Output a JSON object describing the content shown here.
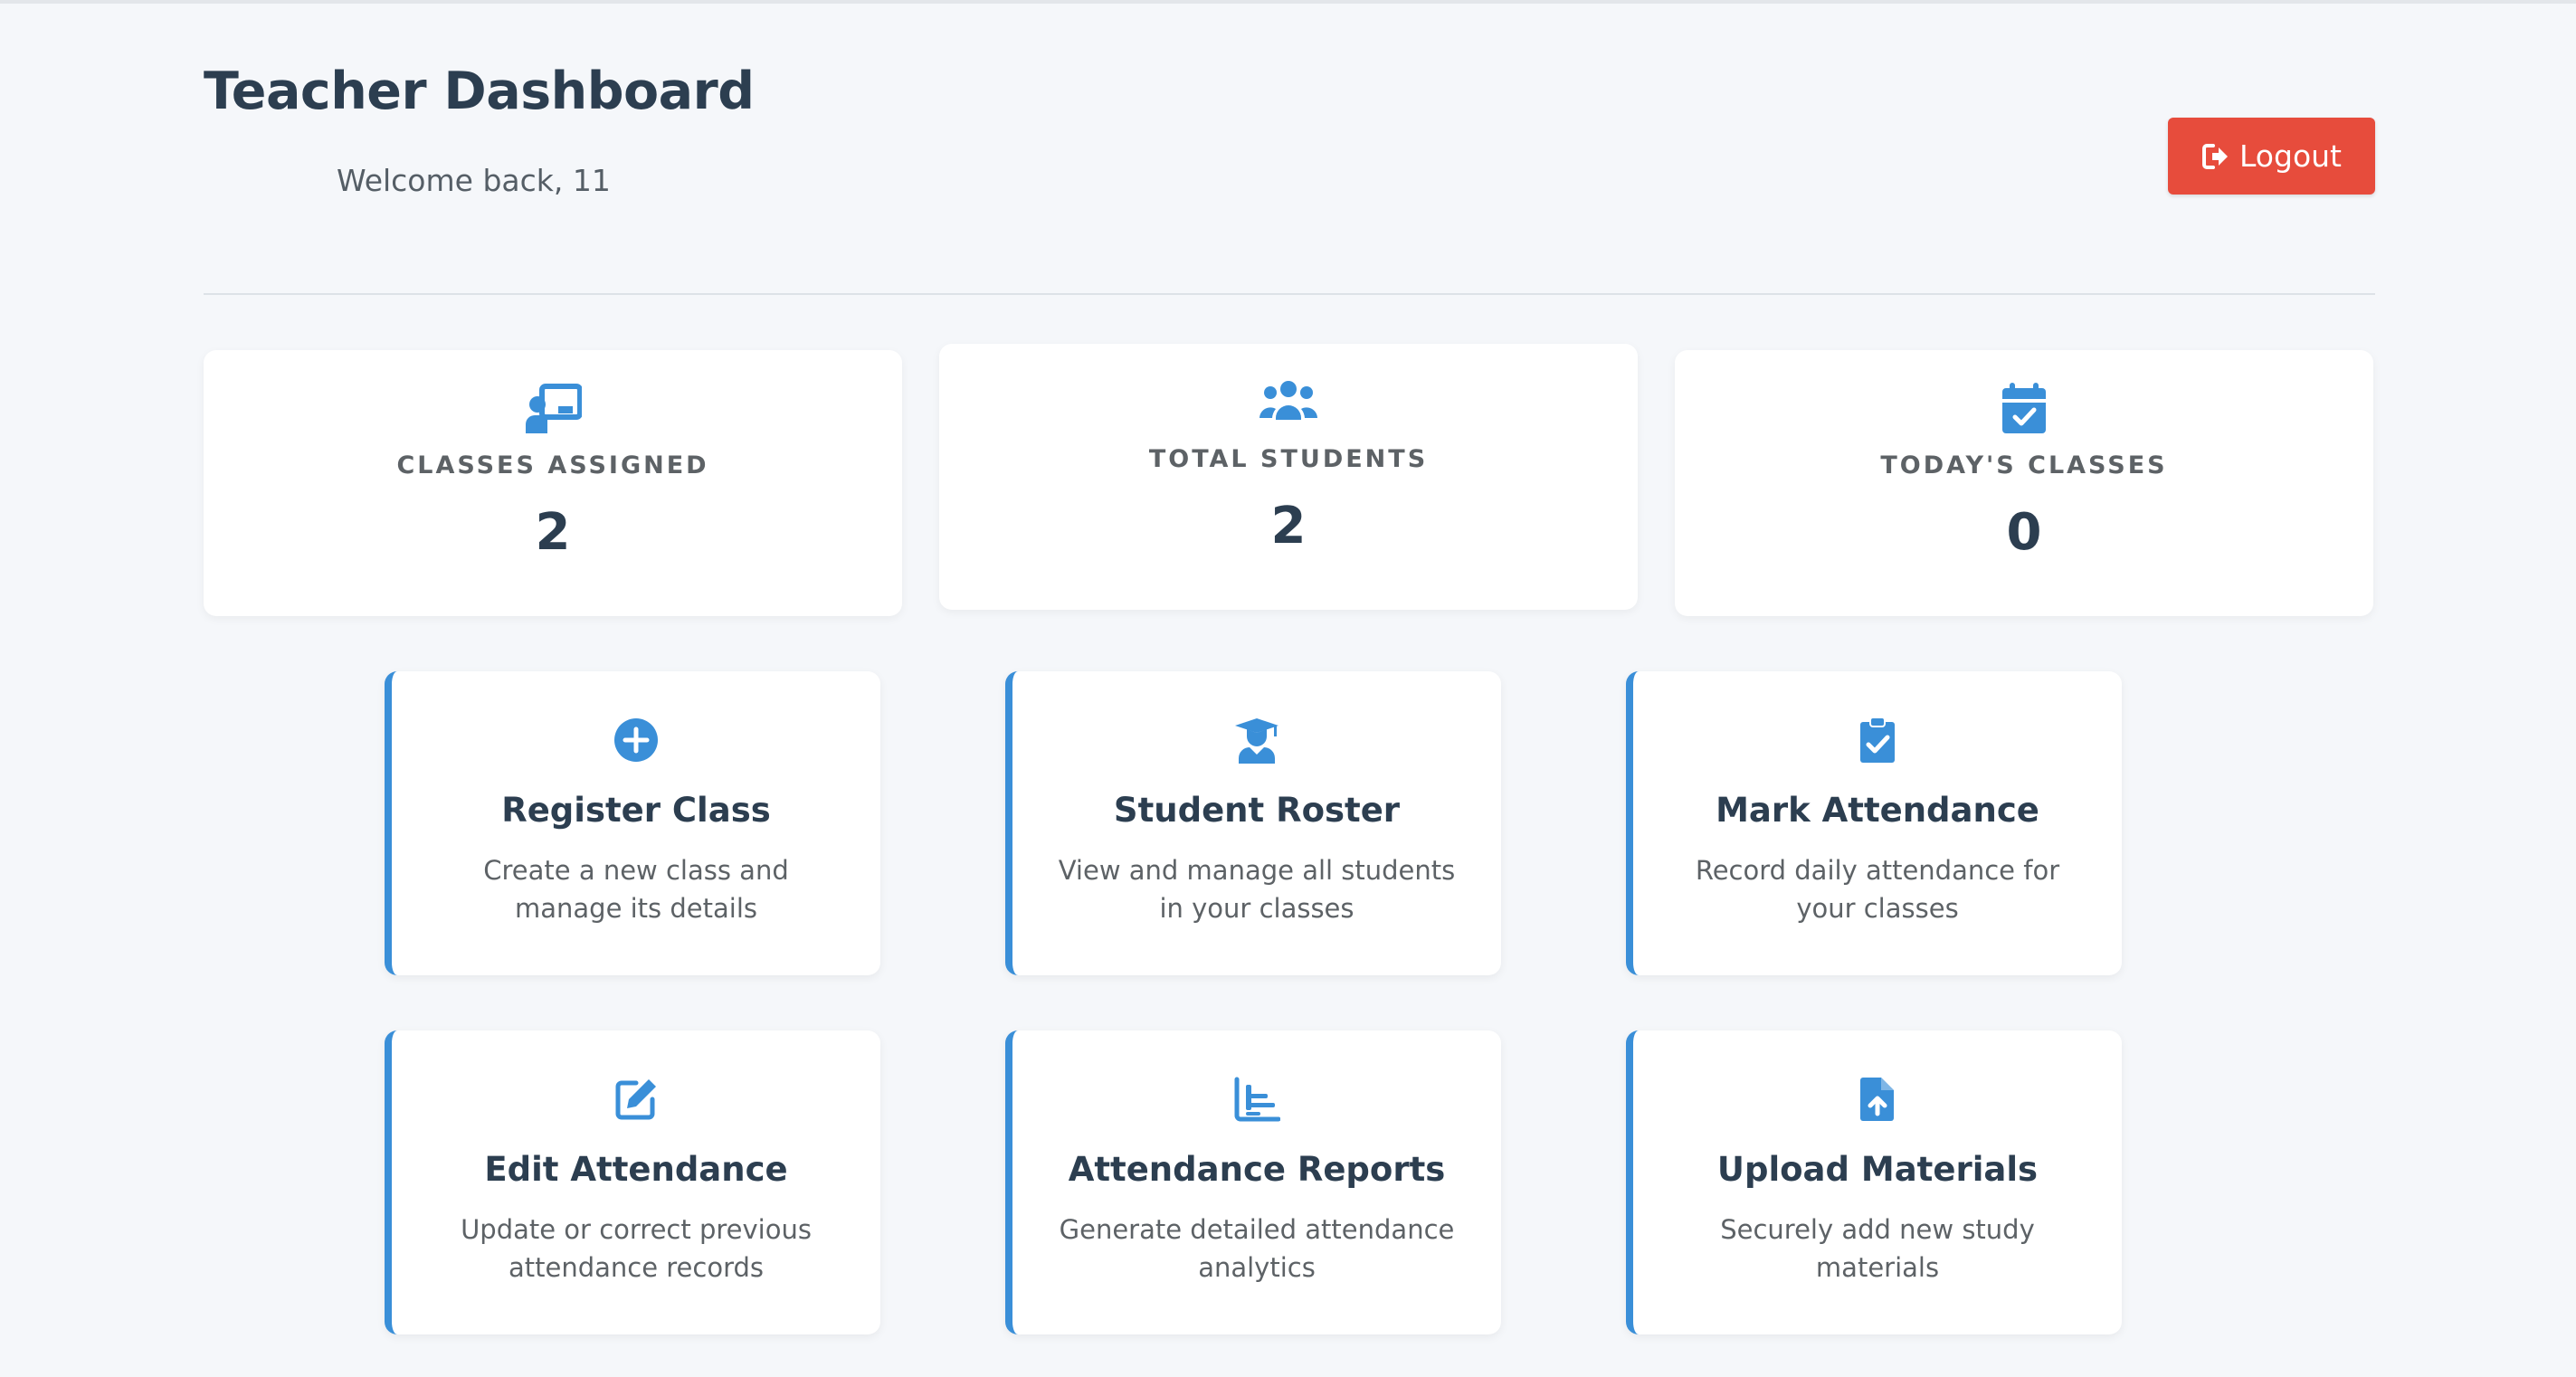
{
  "header": {
    "title": "Teacher Dashboard",
    "welcome": "Welcome back, 11",
    "logout_label": "Logout"
  },
  "colors": {
    "accent": "#3a8fd8",
    "logout": "#e74c3c",
    "heading": "#2c3e50",
    "background": "#f5f7fa"
  },
  "stats": [
    {
      "icon": "chalkboard-teacher-icon",
      "label": "CLASSES ASSIGNED",
      "value": "2"
    },
    {
      "icon": "users-icon",
      "label": "TOTAL STUDENTS",
      "value": "2"
    },
    {
      "icon": "calendar-check-icon",
      "label": "TODAY'S CLASSES",
      "value": "0"
    }
  ],
  "actions": [
    {
      "icon": "plus-circle-icon",
      "title": "Register Class",
      "description": "Create a new class and manage its details"
    },
    {
      "icon": "user-graduate-icon",
      "title": "Student Roster",
      "description": "View and manage all students in your classes"
    },
    {
      "icon": "clipboard-check-icon",
      "title": "Mark Attendance",
      "description": "Record daily attendance for your classes"
    },
    {
      "icon": "edit-icon",
      "title": "Edit Attendance",
      "description": "Update or correct previous attendance records"
    },
    {
      "icon": "chart-bar-icon",
      "title": "Attendance Reports",
      "description": "Generate detailed attendance analytics"
    },
    {
      "icon": "file-upload-icon",
      "title": "Upload Materials",
      "description": "Securely add new study materials"
    }
  ]
}
